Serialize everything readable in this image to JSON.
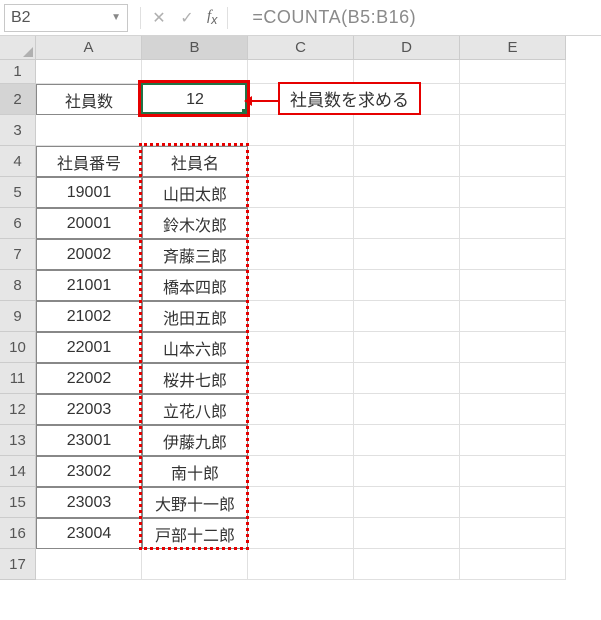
{
  "nameBox": "B2",
  "formula": "=COUNTA(B5:B16)",
  "columns": [
    "A",
    "B",
    "C",
    "D",
    "E"
  ],
  "rows": [
    "1",
    "2",
    "3",
    "4",
    "5",
    "6",
    "7",
    "8",
    "9",
    "10",
    "11",
    "12",
    "13",
    "14",
    "15",
    "16",
    "17"
  ],
  "activeCell": "B2",
  "callout": "社員数を求める",
  "cells": {
    "A2": "社員数",
    "B2": "12",
    "A4": "社員番号",
    "B4": "社員名",
    "A5": "19001",
    "B5": "山田太郎",
    "A6": "20001",
    "B6": "鈴木次郎",
    "A7": "20002",
    "B7": "斉藤三郎",
    "A8": "21001",
    "B8": "橋本四郎",
    "A9": "21002",
    "B9": "池田五郎",
    "A10": "22001",
    "B10": "山本六郎",
    "A11": "22002",
    "B11": "桜井七郎",
    "A12": "22003",
    "B12": "立花八郎",
    "A13": "23001",
    "B13": "伊藤九郎",
    "A14": "23002",
    "B14": "南十郎",
    "A15": "23003",
    "B15": "大野十一郎",
    "A16": "23004",
    "B16": "戸部十二郎"
  }
}
